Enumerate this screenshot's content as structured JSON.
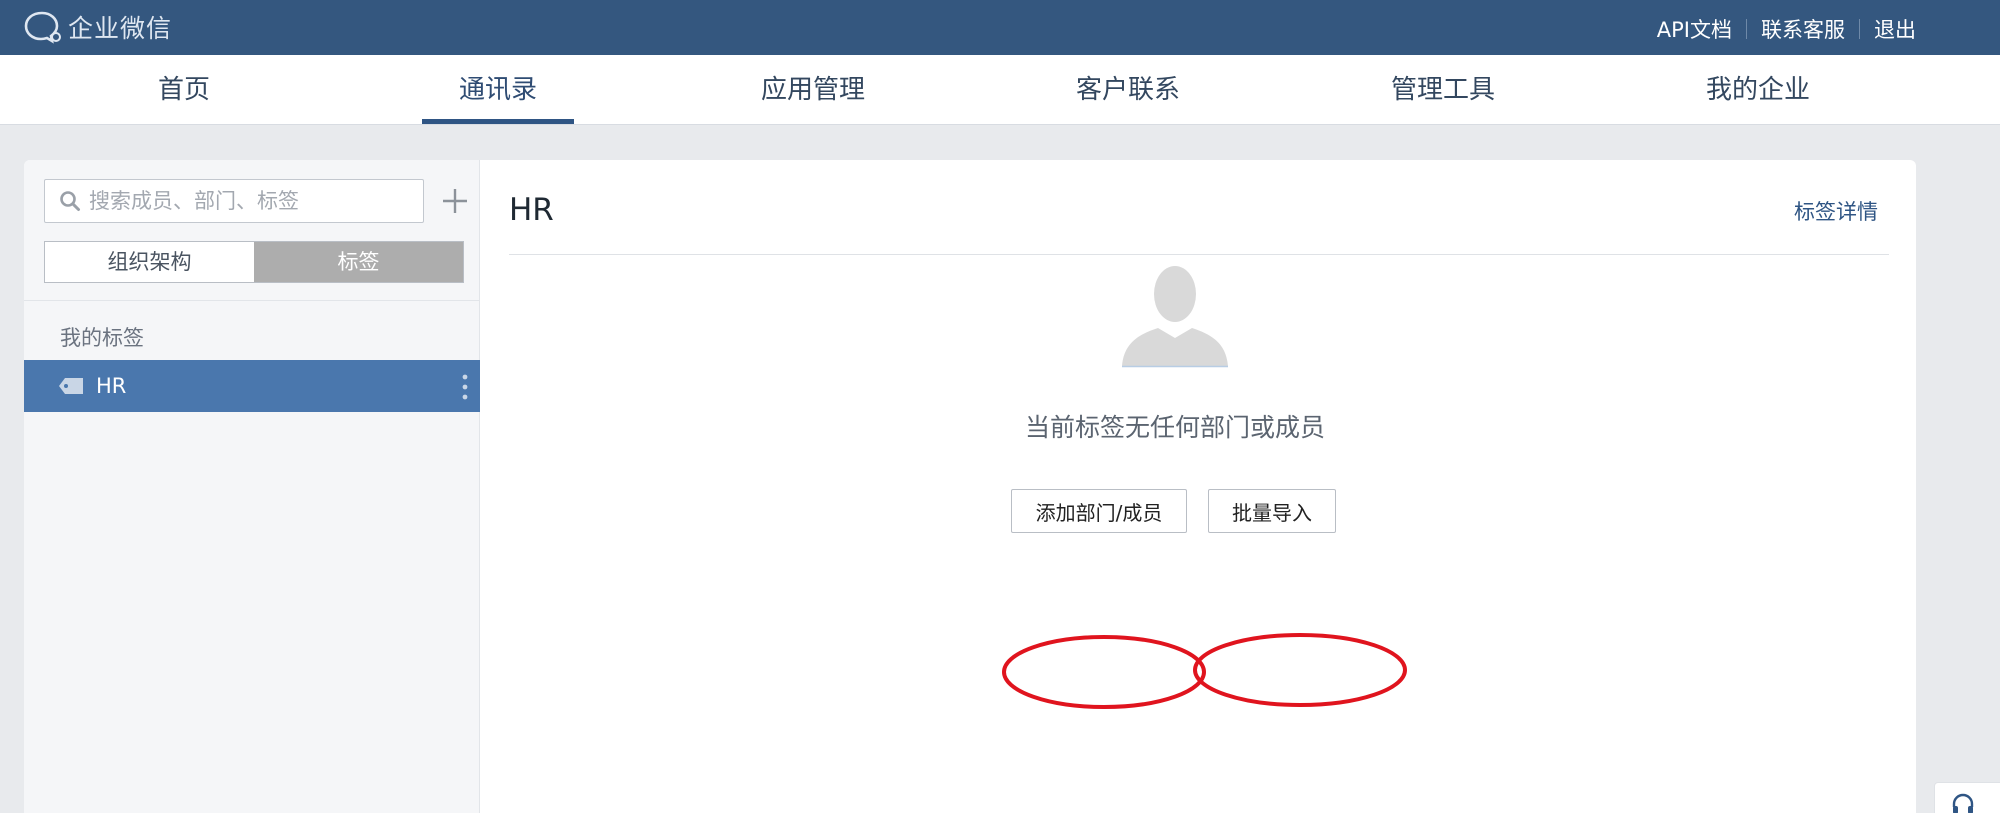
{
  "brand": {
    "name": "企业微信"
  },
  "top_links": [
    {
      "label": "API文档"
    },
    {
      "label": "联系客服"
    },
    {
      "label": "退出"
    }
  ],
  "nav": {
    "active_index": 1,
    "items": [
      {
        "label": "首页"
      },
      {
        "label": "通讯录"
      },
      {
        "label": "应用管理"
      },
      {
        "label": "客户联系"
      },
      {
        "label": "管理工具"
      },
      {
        "label": "我的企业"
      }
    ]
  },
  "sidebar": {
    "search_placeholder": "搜索成员、部门、标签",
    "segments": [
      {
        "label": "组织架构"
      },
      {
        "label": "标签"
      }
    ],
    "active_segment": 1,
    "group_label": "我的标签",
    "tags": [
      {
        "name": "HR"
      }
    ]
  },
  "panel": {
    "title": "HR",
    "detail_link": "标签详情",
    "empty_message": "当前标签无任何部门或成员",
    "add_button": "添加部门/成员",
    "import_button": "批量导入"
  },
  "colors": {
    "topbar": "#34577f",
    "accent": "#2f5584",
    "selected_row": "#4a77ad",
    "annotation": "#e0141e"
  }
}
